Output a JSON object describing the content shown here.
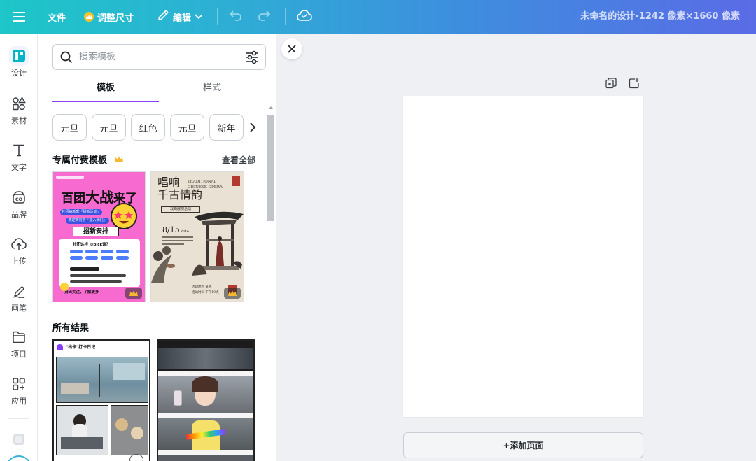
{
  "topbar": {
    "file": "文件",
    "resize": "调整尺寸",
    "edit": "编辑",
    "doc_title": "未命名的设计-1242 像素×1660 像素"
  },
  "rail": {
    "items": [
      {
        "label": "设计",
        "icon": "design-icon"
      },
      {
        "label": "素材",
        "icon": "elements-icon"
      },
      {
        "label": "文字",
        "icon": "text-icon"
      },
      {
        "label": "品牌",
        "icon": "brand-icon"
      },
      {
        "label": "上传",
        "icon": "upload-icon"
      },
      {
        "label": "画笔",
        "icon": "draw-icon"
      },
      {
        "label": "项目",
        "icon": "projects-icon"
      },
      {
        "label": "应用",
        "icon": "apps-icon"
      }
    ]
  },
  "panel": {
    "search_placeholder": "搜索模板",
    "tabs": [
      "模板",
      "样式"
    ],
    "chips": [
      "元旦",
      "元旦",
      "红色",
      "元旦",
      "新年"
    ],
    "premium_title": "专属付费模板",
    "see_all": "查看全部",
    "all_results": "所有结果",
    "card1": {
      "title_a": "百团",
      "title_b": "大战",
      "title_c": "来了",
      "line1": "社团纳新季「招新活动」",
      "line2": "欢迎新同学「加入我们」",
      "section": "招新安排",
      "ask": "社团这样 @pick谁？",
      "footer": "扫码关注，了解更多"
    },
    "card2": {
      "title": "唱响",
      "title2": "千古情韵",
      "en1": "TRADITIONAL",
      "en2": "CHINESE OPERA",
      "sub": "戏曲展演活动",
      "date": "8/15",
      "date_en": "date",
      "info1": "活动地点  某地",
      "info2": "活动时间  下午19点"
    },
    "card3": {
      "header": "\"出卡\"打卡日记"
    }
  },
  "canvas": {
    "add_page": "+添加页面"
  },
  "colors": {
    "accent": "#8b3dff",
    "topbar_start": "#1dc6c8",
    "topbar_end": "#5a6be6",
    "crown": "#f5c330"
  }
}
